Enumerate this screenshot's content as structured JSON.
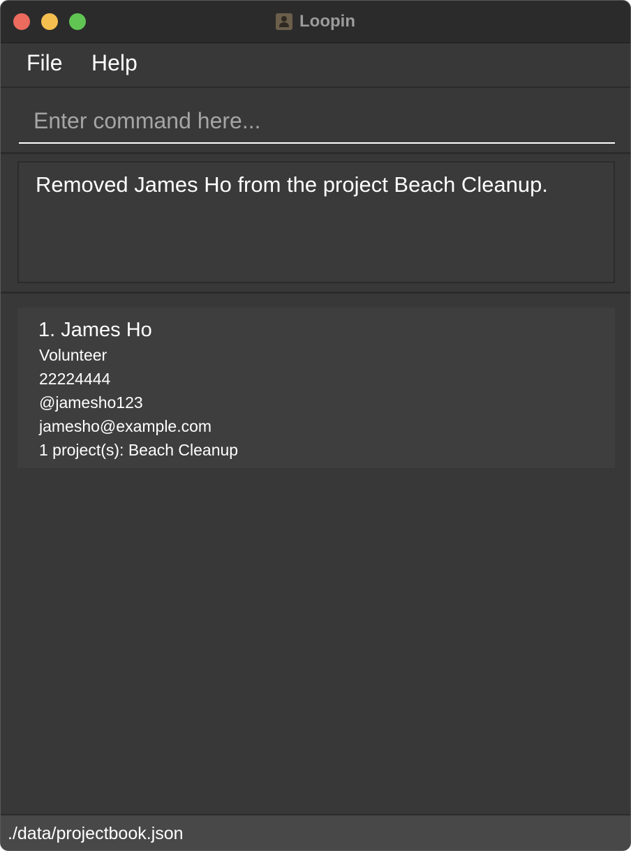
{
  "window": {
    "title": "Loopin",
    "app_icon": "contacts-icon"
  },
  "menu": {
    "items": [
      "File",
      "Help"
    ]
  },
  "command": {
    "placeholder": "Enter command here...",
    "value": ""
  },
  "result": {
    "message": "Removed James Ho from the project Beach Cleanup."
  },
  "persons": [
    {
      "index_name": "1. James Ho",
      "role": "Volunteer",
      "phone": "22224444",
      "telegram": "@jamesho123",
      "email": "jamesho@example.com",
      "projects": "1 project(s): Beach Cleanup"
    }
  ],
  "status": {
    "file_path": "./data/projectbook.json"
  },
  "colors": {
    "window_bg": "#383838",
    "titlebar_bg": "#2b2b2b",
    "card_bg": "#3e3e3e",
    "statusbar_bg": "#484848",
    "close": "#ed6a5e",
    "minimize": "#f5bf4f",
    "maximize": "#61c554"
  }
}
